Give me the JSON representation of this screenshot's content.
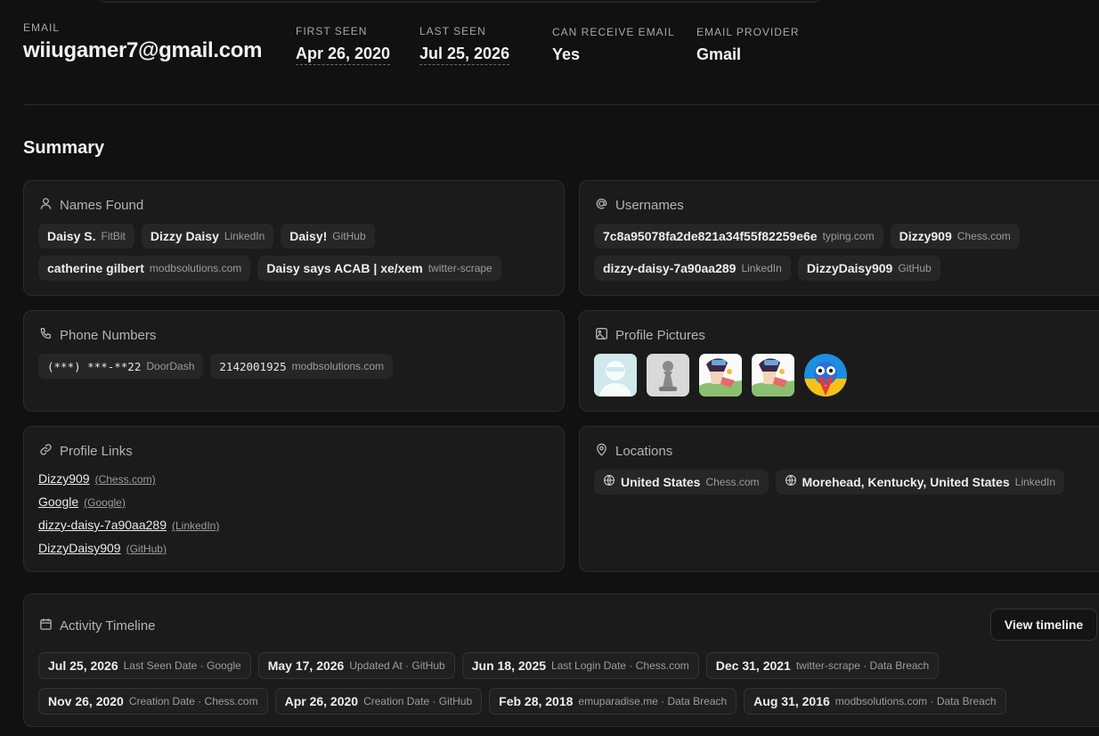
{
  "header": {
    "email_label": "EMAIL",
    "email": "wiiugamer7@gmail.com",
    "first_seen_label": "FIRST SEEN",
    "first_seen": "Apr 26, 2020",
    "last_seen_label": "LAST SEEN",
    "last_seen": "Jul 25, 2026",
    "can_receive_label": "CAN RECEIVE EMAIL",
    "can_receive": "Yes",
    "provider_label": "EMAIL PROVIDER",
    "provider": "Gmail"
  },
  "summary_title": "Summary",
  "names": {
    "title": "Names Found",
    "icon": "user-icon",
    "items": [
      {
        "value": "Daisy S.",
        "source": "FitBit"
      },
      {
        "value": "Dizzy Daisy",
        "source": "LinkedIn"
      },
      {
        "value": "Daisy!",
        "source": "GitHub"
      },
      {
        "value": "catherine gilbert",
        "source": "modbsolutions.com"
      },
      {
        "value": "Daisy says ACAB | xe/xem",
        "source": "twitter-scrape"
      }
    ]
  },
  "usernames": {
    "title": "Usernames",
    "icon": "at-sign-icon",
    "items": [
      {
        "value": "7c8a95078fa2de821a34f55f82259e6e",
        "source": "typing.com"
      },
      {
        "value": "Dizzy909",
        "source": "Chess.com"
      },
      {
        "value": "dizzy-daisy-7a90aa289",
        "source": "LinkedIn"
      },
      {
        "value": "DizzyDaisy909",
        "source": "GitHub"
      }
    ]
  },
  "phones": {
    "title": "Phone Numbers",
    "icon": "phone-icon",
    "items": [
      {
        "value": "(***) ***-**22",
        "source": "DoorDash"
      },
      {
        "value": "2142001925",
        "source": "modbsolutions.com"
      }
    ]
  },
  "pictures": {
    "title": "Profile Pictures",
    "icon": "image-icon",
    "items": [
      "avatar-placeholder",
      "chess-pawn",
      "cartoon-character",
      "cartoon-character",
      "colorful-bird"
    ]
  },
  "links": {
    "title": "Profile Links",
    "icon": "link-icon",
    "items": [
      {
        "value": "Dizzy909",
        "source": "(Chess.com)"
      },
      {
        "value": "Google",
        "source": "(Google)"
      },
      {
        "value": "dizzy-daisy-7a90aa289",
        "source": "(LinkedIn)"
      },
      {
        "value": "DizzyDaisy909",
        "source": "(GitHub)"
      }
    ]
  },
  "locations": {
    "title": "Locations",
    "icon": "map-pin-icon",
    "items": [
      {
        "value": "United States",
        "source": "Chess.com"
      },
      {
        "value": "Morehead, Kentucky, United States",
        "source": "LinkedIn"
      }
    ]
  },
  "timeline": {
    "title": "Activity Timeline",
    "icon": "calendar-icon",
    "button": "View timeline",
    "items": [
      {
        "date": "Jul 25, 2026",
        "desc": "Last Seen Date · Google"
      },
      {
        "date": "May 17, 2026",
        "desc": "Updated At · GitHub"
      },
      {
        "date": "Jun 18, 2025",
        "desc": "Last Login Date · Chess.com"
      },
      {
        "date": "Dec 31, 2021",
        "desc": "twitter-scrape · Data Breach"
      },
      {
        "date": "Nov 26, 2020",
        "desc": "Creation Date · Chess.com"
      },
      {
        "date": "Apr 26, 2020",
        "desc": "Creation Date · GitHub"
      },
      {
        "date": "Feb 28, 2018",
        "desc": "emuparadise.me · Data Breach"
      },
      {
        "date": "Aug 31, 2016",
        "desc": "modbsolutions.com · Data Breach"
      }
    ]
  }
}
